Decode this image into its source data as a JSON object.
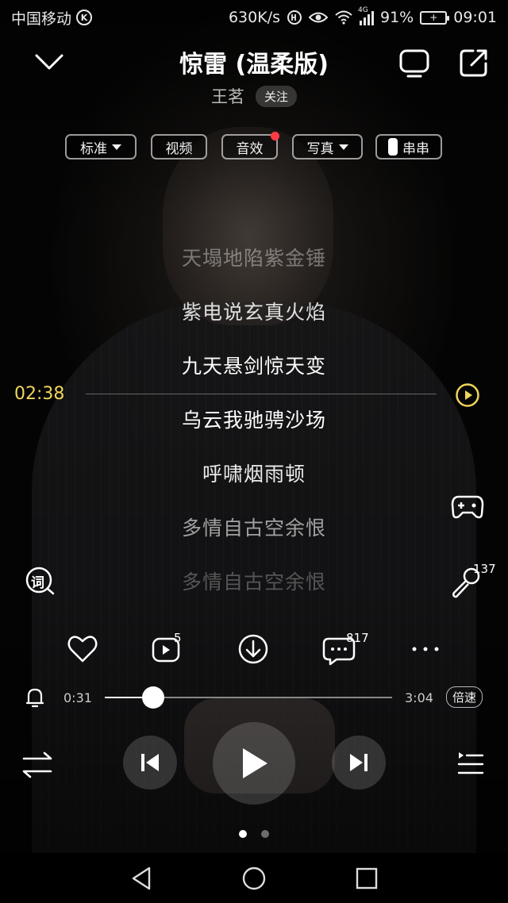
{
  "status_bar": {
    "carrier": "中国移动",
    "carrier_badge": "K",
    "net_speed": "630K/s",
    "network_type": "4G",
    "battery": "91%",
    "time": "09:01"
  },
  "header": {
    "title": "惊雷 (温柔版)",
    "artist": "王茗",
    "follow_label": "关注"
  },
  "toolbar": {
    "standard_label": "标准",
    "video_label": "视频",
    "effects_label": "音效",
    "photo_label": "写真",
    "chuan_label": "串串"
  },
  "lyrics": {
    "lines": [
      "天塌地陷紫金锤",
      "紫电说玄真火焰",
      "九天悬剑惊天变",
      "乌云我驰骋沙场",
      "呼啸烟雨顿",
      "多情自古空余恨",
      "多情自古空余恨"
    ],
    "seek_time": "02:38",
    "lyric_icon_label": "词",
    "karaoke_count": "137"
  },
  "actions": {
    "mv_count": "5",
    "comment_count": "817"
  },
  "progress": {
    "current": "0:31",
    "duration": "3:04",
    "fraction": 0.168,
    "speed_label": "倍速"
  },
  "pager": {
    "pages": 2,
    "active": 0
  },
  "colors": {
    "accent": "#f0d65a",
    "badge_dot": "#ff3b46"
  }
}
